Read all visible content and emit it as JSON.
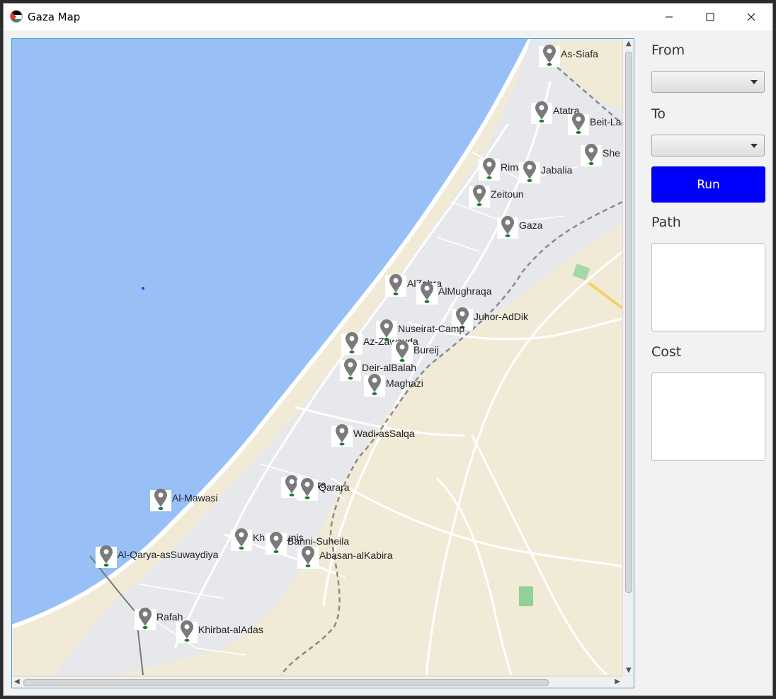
{
  "window": {
    "title": "Gaza Map"
  },
  "controls": {
    "minimize": "—",
    "maximize": "☐",
    "close": "✕"
  },
  "panel": {
    "from_label": "From",
    "from_value": "",
    "to_label": "To",
    "to_value": "",
    "run_label": "Run",
    "path_label": "Path",
    "path_value": "",
    "cost_label": "Cost",
    "cost_value": ""
  },
  "colors": {
    "run_button": "#0000ff",
    "sea": "#99bff7",
    "land": "#f0ead7",
    "urban": "#e7e8ec",
    "pin": "#7a7a7a",
    "pin_base": "#1e7a2e"
  },
  "map": {
    "locations": [
      "As-Siafa",
      "Atatra",
      "Beit-La",
      "She",
      "Rimal",
      "Jabalia",
      "Zeitoun",
      "Gaza",
      "AlZahra",
      "AlMughraqa",
      "Juhor-AdDik",
      "Nuseirat-Camp",
      "Az-Zawayda",
      "Bureij",
      "Deir-alBalah",
      "Maghazi",
      "Wadi-asSalqa",
      "arara",
      "Qarara",
      "Al-Mawasi",
      "Khan-Yunis",
      "Banni-Suheila",
      "Abasan-alKabira",
      "Al-Qarya-asSuwaydiya",
      "Rafah",
      "Khirbat-alAdas"
    ]
  }
}
